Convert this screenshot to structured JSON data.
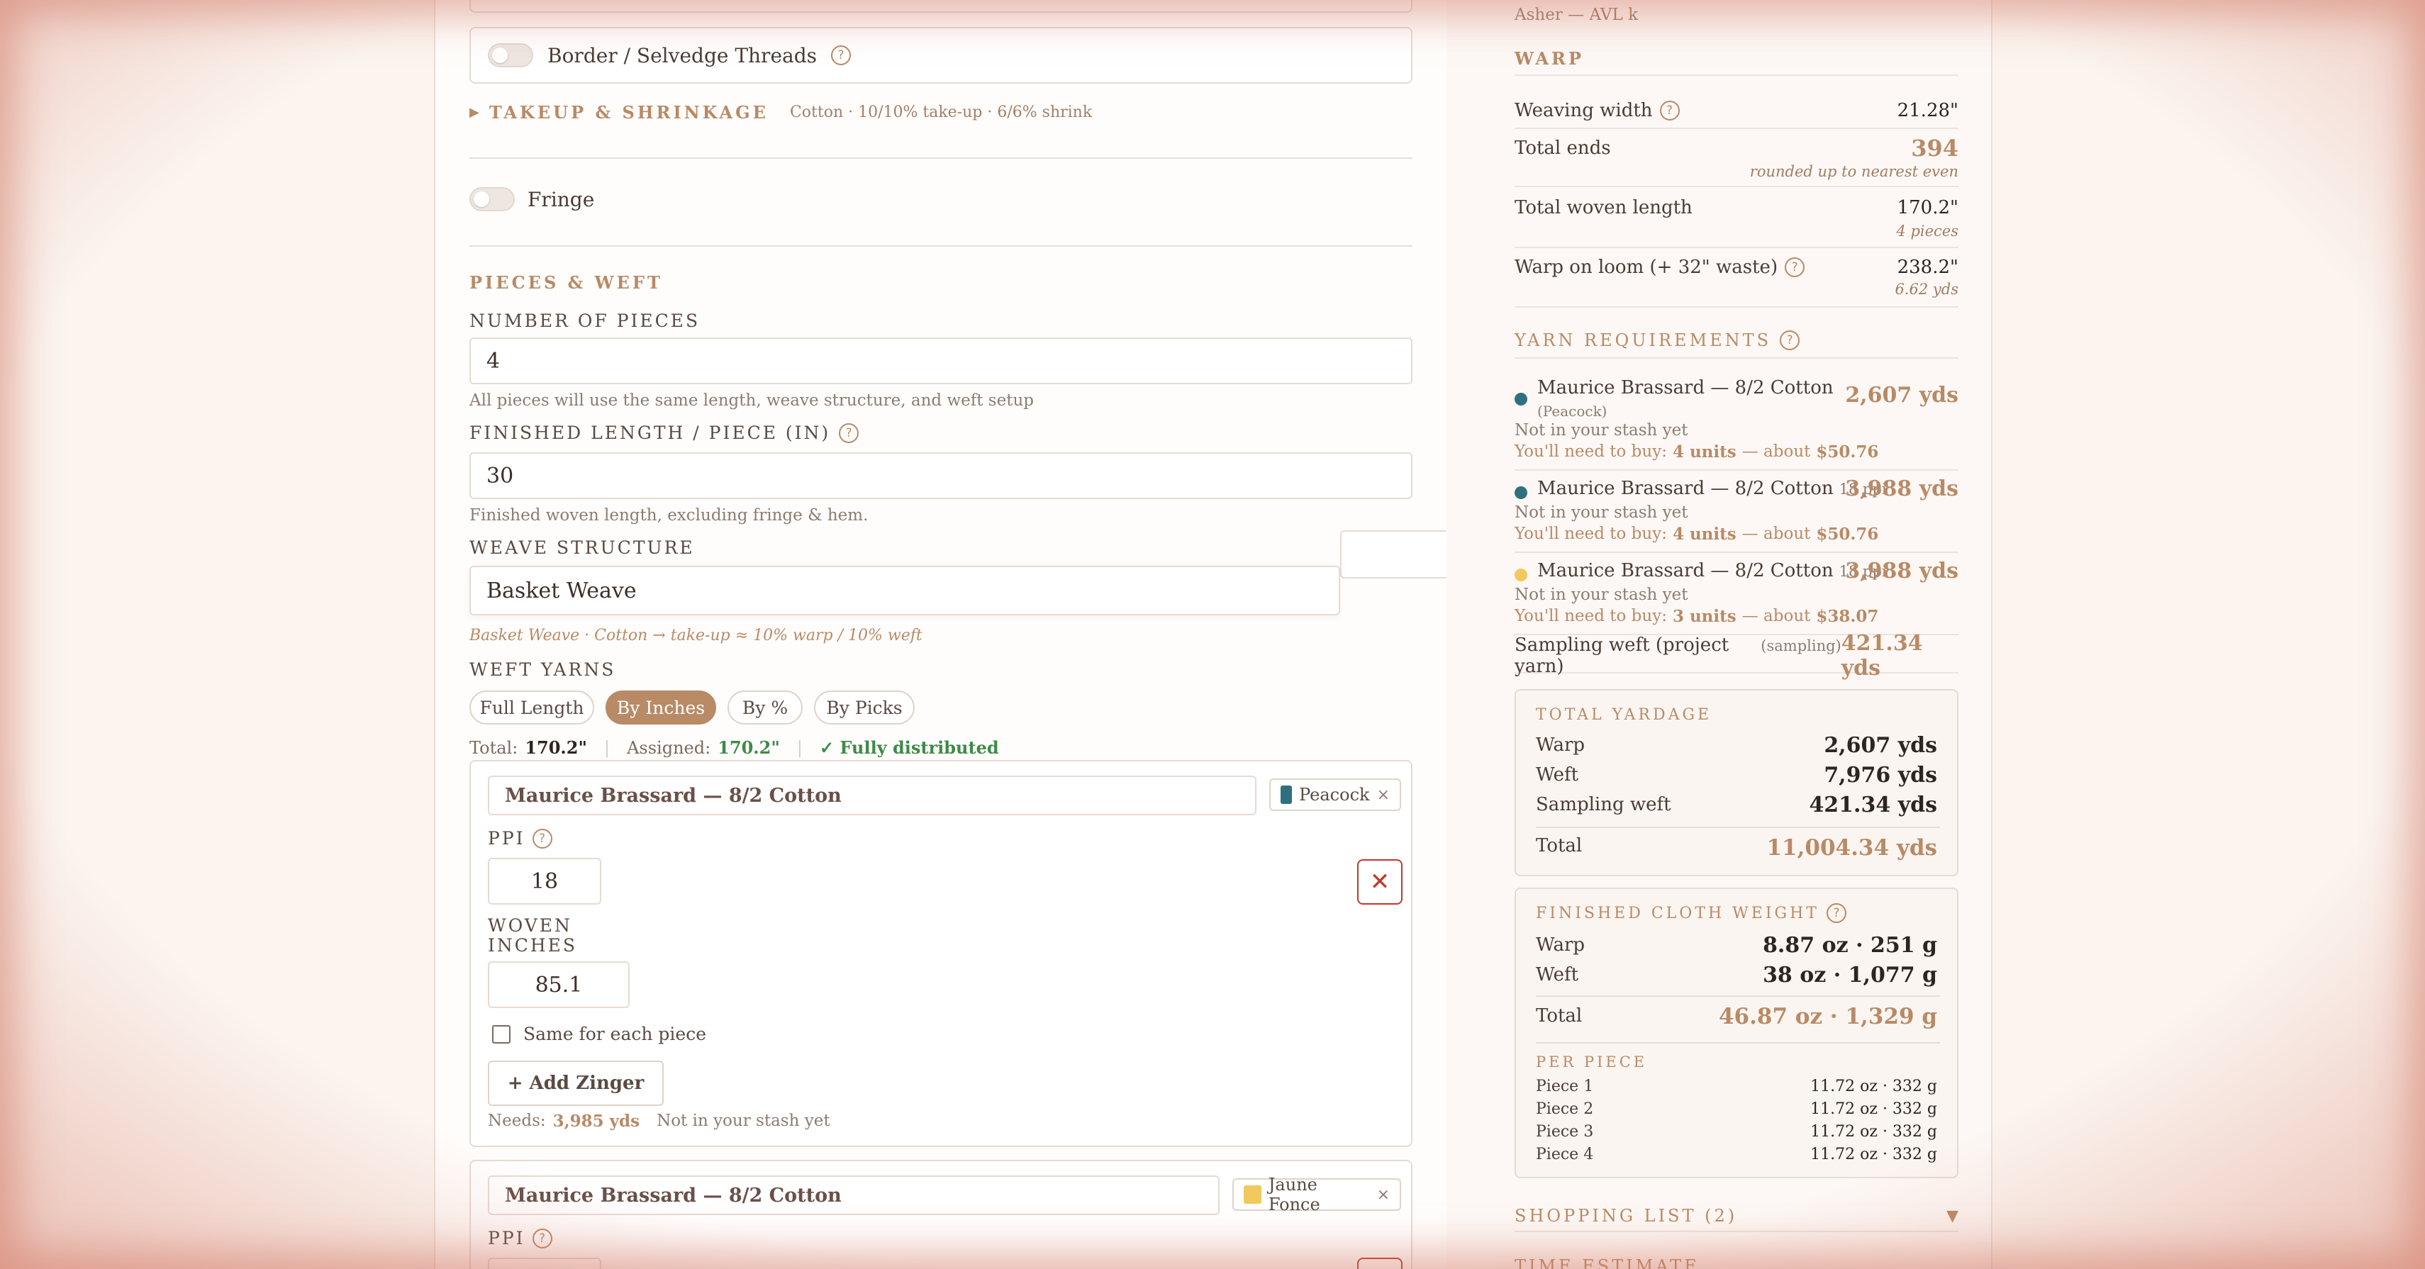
{
  "main": {
    "border_threads_label": "Border / Selvedge Threads",
    "takeup_label": "TAKEUP & SHRINKAGE",
    "takeup_summary": "Cotton · 10/10% take-up · 6/6% shrink",
    "fringe_label": "Fringe",
    "pieces_weft_heading": "PIECES & WEFT",
    "num_pieces_label": "NUMBER OF PIECES",
    "num_pieces_value": "4",
    "num_pieces_hint": "All pieces will use the same length, weave structure, and weft setup",
    "finished_length_label": "FINISHED LENGTH / PIECE (IN)",
    "finished_length_value": "30",
    "finished_length_hint": "Finished woven length, excluding fringe & hem.",
    "weave_structure_label": "WEAVE STRUCTURE",
    "weave_structure_value": "Basket Weave",
    "weave_hint": "Basket Weave · Cotton → take-up ≈ 10% warp / 10% weft",
    "weft_yarns_label": "WEFT YARNS",
    "weft_modes": [
      "Full Length",
      "By Inches",
      "By %",
      "By Picks"
    ],
    "weft_active_mode": "By Inches",
    "total_label": "Total:",
    "total_value": "170.2\"",
    "assigned_label": "Assigned:",
    "assigned_value": "170.2\"",
    "distributed_status": "✓ Fully distributed",
    "weft1": {
      "yarn": "Maurice Brassard — 8/2 Cotton",
      "color_name": "Peacock",
      "color": "#2f7080",
      "ppi_label": "PPI",
      "ppi_value": "18",
      "woven_inches_label_1": "WOVEN",
      "woven_inches_label_2": "INCHES",
      "woven_inches_value": "85.1",
      "same_each_piece": "Same for each piece",
      "add_zinger": "+ Add Zinger",
      "needs_label": "Needs:",
      "needs_value": "3,985 yds",
      "stash_status": "Not in your stash yet"
    },
    "weft2": {
      "yarn": "Maurice Brassard — 8/2 Cotton",
      "color_name": "Jaune Fonce",
      "color": "#f2c95c",
      "ppi_label": "PPI"
    }
  },
  "side": {
    "loom_info": "Asher — AVL k",
    "warp_heading": "WARP",
    "weaving_width_label": "Weaving width",
    "weaving_width_value": "21.28\"",
    "total_ends_label": "Total ends",
    "total_ends_value": "394",
    "total_ends_sub": "rounded up to nearest even",
    "total_woven_label": "Total woven length",
    "total_woven_value": "170.2\"",
    "total_woven_sub": "4 pieces",
    "warp_on_loom_label": "Warp on loom (+ 32\" waste)",
    "warp_on_loom_value": "238.2\"",
    "warp_on_loom_sub": "6.62 yds",
    "yarn_req_heading": "YARN REQUIREMENTS",
    "yarns": [
      {
        "name": "Maurice Brassard — 8/2 Cotton",
        "detail": "(Peacock)",
        "amount": "2,607 yds",
        "stash": "Not in your stash yet",
        "buy_prefix": "You'll need to buy:",
        "units": "4 units",
        "about": "— about",
        "price": "$50.76",
        "color": "#2f7080"
      },
      {
        "name": "Maurice Brassard — 8/2 Cotton",
        "detail": "18 ppi",
        "amount": "3,988 yds",
        "stash": "Not in your stash yet",
        "buy_prefix": "You'll need to buy:",
        "units": "4 units",
        "about": "— about",
        "price": "$50.76",
        "color": "#2f7080"
      },
      {
        "name": "Maurice Brassard — 8/2 Cotton",
        "detail": "18 ppi",
        "amount": "3,988 yds",
        "stash": "Not in your stash yet",
        "buy_prefix": "You'll need to buy:",
        "units": "3 units",
        "about": "— about",
        "price": "$38.07",
        "color": "#f2c95c"
      }
    ],
    "sampling_label": "Sampling weft (project yarn)",
    "sampling_tag": "(sampling)",
    "sampling_value": "421.34 yds",
    "total_yardage": {
      "heading": "TOTAL YARDAGE",
      "warp_label": "Warp",
      "warp_value": "2,607 yds",
      "weft_label": "Weft",
      "weft_value": "7,976 yds",
      "sampling_label": "Sampling weft",
      "sampling_value": "421.34 yds",
      "total_label": "Total",
      "total_value": "11,004.34 yds"
    },
    "cloth_weight": {
      "heading": "FINISHED CLOTH WEIGHT",
      "warp_label": "Warp",
      "warp_value": "8.87 oz · 251 g",
      "weft_label": "Weft",
      "weft_value": "38 oz · 1,077 g",
      "total_label": "Total",
      "total_value": "46.87 oz · 1,329 g",
      "per_piece_heading": "PER PIECE",
      "pieces": [
        {
          "label": "Piece 1",
          "value": "11.72 oz · 332 g"
        },
        {
          "label": "Piece 2",
          "value": "11.72 oz · 332 g"
        },
        {
          "label": "Piece 3",
          "value": "11.72 oz · 332 g"
        },
        {
          "label": "Piece 4",
          "value": "11.72 oz · 332 g"
        }
      ]
    },
    "shopping_list": "SHOPPING LIST (2)",
    "time_estimate": "TIME ESTIMATE"
  }
}
